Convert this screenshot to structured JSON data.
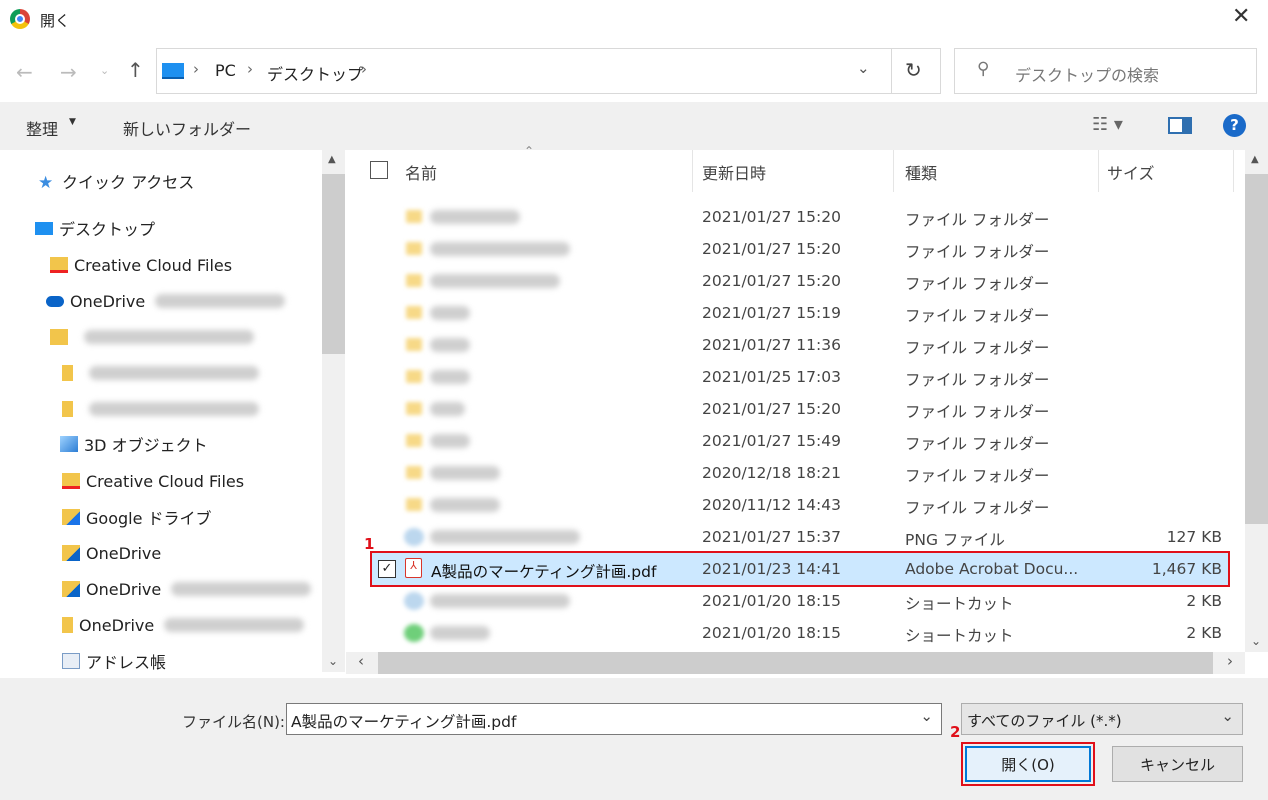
{
  "title": "開く",
  "nav": {
    "breadcrumb": [
      "PC",
      "デスクトップ"
    ],
    "search_placeholder": "デスクトップの検索"
  },
  "toolbar": {
    "organize": "整理",
    "new_folder": "新しいフォルダー"
  },
  "sidebar": {
    "items": [
      {
        "label": "クイック アクセス",
        "icon": "star-icon"
      },
      {
        "label": "デスクトップ",
        "icon": "desktop-icon"
      },
      {
        "label": "Creative Cloud Files",
        "icon": "creative-cloud-folder-icon"
      },
      {
        "label": "OneDrive",
        "icon": "onedrive-cloud-icon"
      },
      {
        "label": "",
        "icon": "user-folder-icon"
      },
      {
        "label": "",
        "icon": "folder-icon"
      },
      {
        "label": "",
        "icon": "folder-icon"
      },
      {
        "label": "3D オブジェクト",
        "icon": "3d-objects-icon"
      },
      {
        "label": "Creative Cloud Files",
        "icon": "creative-cloud-folder-icon"
      },
      {
        "label": "Google ドライブ",
        "icon": "google-drive-folder-icon"
      },
      {
        "label": "OneDrive",
        "icon": "onedrive-folder-icon"
      },
      {
        "label": "OneDrive",
        "icon": "onedrive-folder-icon"
      },
      {
        "label": "OneDrive",
        "icon": "folder-icon"
      },
      {
        "label": "アドレス帳",
        "icon": "contacts-icon"
      }
    ]
  },
  "columns": {
    "name": "名前",
    "date": "更新日時",
    "type": "種類",
    "size": "サイズ"
  },
  "files": [
    {
      "name": "",
      "date": "2021/01/27 15:20",
      "type": "ファイル フォルダー",
      "size": "",
      "icon": "folder"
    },
    {
      "name": "",
      "date": "2021/01/27 15:20",
      "type": "ファイル フォルダー",
      "size": "",
      "icon": "folder"
    },
    {
      "name": "",
      "date": "2021/01/27 15:20",
      "type": "ファイル フォルダー",
      "size": "",
      "icon": "folder"
    },
    {
      "name": "",
      "date": "2021/01/27 15:19",
      "type": "ファイル フォルダー",
      "size": "",
      "icon": "folder"
    },
    {
      "name": "",
      "date": "2021/01/27 11:36",
      "type": "ファイル フォルダー",
      "size": "",
      "icon": "folder"
    },
    {
      "name": "",
      "date": "2021/01/25 17:03",
      "type": "ファイル フォルダー",
      "size": "",
      "icon": "folder"
    },
    {
      "name": "",
      "date": "2021/01/27 15:20",
      "type": "ファイル フォルダー",
      "size": "",
      "icon": "folder"
    },
    {
      "name": "",
      "date": "2021/01/27 15:49",
      "type": "ファイル フォルダー",
      "size": "",
      "icon": "folder"
    },
    {
      "name": "",
      "date": "2020/12/18 18:21",
      "type": "ファイル フォルダー",
      "size": "",
      "icon": "folder"
    },
    {
      "name": "",
      "date": "2020/11/12 14:43",
      "type": "ファイル フォルダー",
      "size": "",
      "icon": "folder"
    },
    {
      "name": "",
      "date": "2021/01/27 15:37",
      "type": "PNG ファイル",
      "size": "127 KB",
      "icon": "png"
    },
    {
      "name": "A製品のマーケティング計画.pdf",
      "date": "2021/01/23 14:41",
      "type": "Adobe Acrobat Docu...",
      "size": "1,467 KB",
      "icon": "pdf",
      "selected": true
    },
    {
      "name": "",
      "date": "2021/01/20 18:15",
      "type": "ショートカット",
      "size": "2 KB",
      "icon": "shortcut"
    },
    {
      "name": "",
      "date": "2021/01/20 18:15",
      "type": "ショートカット",
      "size": "2 KB",
      "icon": "shortcut-green"
    }
  ],
  "footer": {
    "filename_label": "ファイル名(N):",
    "filename_value": "A製品のマーケティング計画.pdf",
    "filter": "すべてのファイル (*.*)",
    "open": "開く(O)",
    "cancel": "キャンセル"
  },
  "annotations": {
    "step1": "1",
    "step2": "2"
  },
  "colors": {
    "accent": "#0078d7",
    "selection": "#cce8ff",
    "annotation": "#e0101a"
  }
}
